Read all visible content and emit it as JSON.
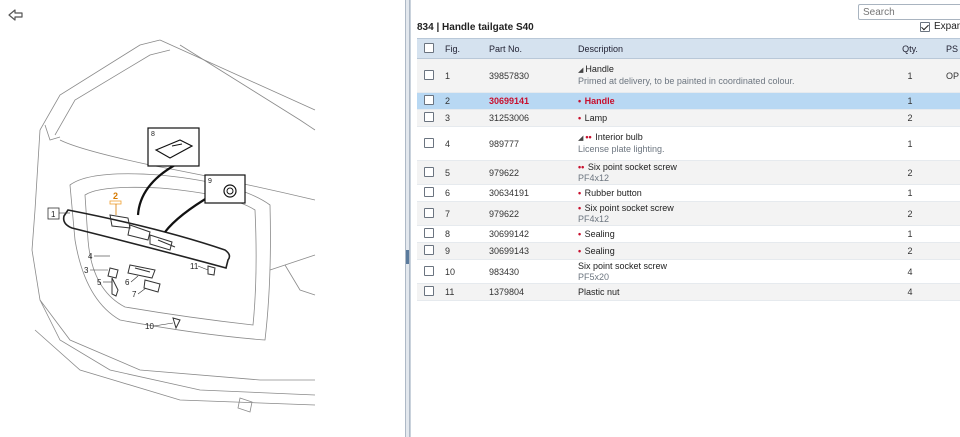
{
  "diagram": {
    "callouts": [
      "1",
      "2",
      "3",
      "4",
      "5",
      "6",
      "7",
      "8",
      "9",
      "10",
      "11"
    ]
  },
  "search": {
    "placeholder": "Search"
  },
  "expand_label": "Expand",
  "title": "834  |  Handle tailgate S40",
  "columns": [
    "Fig.",
    "Part No.",
    "Description",
    "Qty.",
    "PS"
  ],
  "rows": [
    {
      "fig": "1",
      "part": "39857830",
      "bullets": "",
      "tree": true,
      "desc": "Handle",
      "sub": "Primed at delivery, to be painted in coordinated colour.",
      "qty": "1",
      "ps": "OP"
    },
    {
      "fig": "2",
      "part": "30699141",
      "bullets": "•",
      "tree": false,
      "desc": "Handle",
      "sub": "",
      "qty": "1",
      "ps": "",
      "selected": true
    },
    {
      "fig": "3",
      "part": "31253006",
      "bullets": "•",
      "tree": false,
      "desc": "Lamp",
      "sub": "",
      "qty": "2",
      "ps": ""
    },
    {
      "fig": "4",
      "part": "989777",
      "bullets": "••",
      "tree": true,
      "desc": "Interior bulb",
      "sub": "License plate lighting.",
      "qty": "1",
      "ps": ""
    },
    {
      "fig": "5",
      "part": "979622",
      "bullets": "••",
      "tree": false,
      "desc": "Six point socket screw",
      "sub": "PF4x12",
      "qty": "2",
      "ps": ""
    },
    {
      "fig": "6",
      "part": "30634191",
      "bullets": "•",
      "tree": false,
      "desc": "Rubber button",
      "sub": "",
      "qty": "1",
      "ps": ""
    },
    {
      "fig": "7",
      "part": "979622",
      "bullets": "•",
      "tree": false,
      "desc": "Six point socket screw",
      "sub": "PF4x12",
      "qty": "2",
      "ps": ""
    },
    {
      "fig": "8",
      "part": "30699142",
      "bullets": "•",
      "tree": false,
      "desc": "Sealing",
      "sub": "",
      "qty": "1",
      "ps": ""
    },
    {
      "fig": "9",
      "part": "30699143",
      "bullets": "•",
      "tree": false,
      "desc": "Sealing",
      "sub": "",
      "qty": "2",
      "ps": ""
    },
    {
      "fig": "10",
      "part": "983430",
      "bullets": "",
      "tree": false,
      "desc": "Six point socket screw",
      "sub": "PF5x20",
      "qty": "4",
      "ps": ""
    },
    {
      "fig": "11",
      "part": "1379804",
      "bullets": "",
      "tree": false,
      "desc": "Plastic nut",
      "sub": "",
      "qty": "4",
      "ps": ""
    }
  ],
  "colors": {
    "header_bg": "#d5e2ef",
    "selected_bg": "#b8d8f3",
    "accent_red": "#c8102e"
  }
}
